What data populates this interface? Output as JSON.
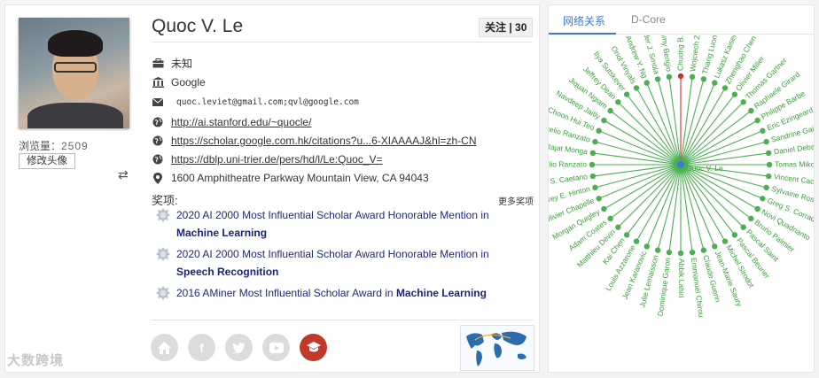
{
  "profile": {
    "views_label": "浏览量：",
    "views_count": "2509",
    "edit_avatar_label": "修改头像",
    "name": "Quoc V. Le",
    "follow_label": "关注 | 30",
    "position": "未知",
    "affiliation": "Google",
    "emails": "quoc.leviet@gmail.com;qvl@google.com",
    "links": [
      "http://ai.stanford.edu/~quocle/",
      "https://scholar.google.com.hk/citations?u...6-XIAAAAJ&hl=zh-CN",
      "https://dblp.uni-trier.de/pers/hd/l/Le:Quoc_V="
    ],
    "address": "1600 Amphitheatre Parkway Mountain View, CA 94043"
  },
  "awards": {
    "title": "奖项:",
    "more_label": "更多奖项",
    "items": [
      {
        "text": "2020 AI 2000 Most Influential Scholar Award Honorable Mention in",
        "field": "Machine Learning"
      },
      {
        "text": "2020 AI 2000 Most Influential Scholar Award Honorable Mention in",
        "field": "Speech Recognition"
      },
      {
        "text": "2016 AMiner Most Influential Scholar Award in",
        "field": "Machine Learning"
      }
    ]
  },
  "social_icons": [
    "home-icon",
    "facebook-icon",
    "twitter-icon",
    "youtube-icon",
    "scholar-cap-icon"
  ],
  "graph_panel": {
    "tabs": [
      "网络关系",
      "D-Core"
    ],
    "active_tab": 0,
    "center_label": "Quoc V. Le",
    "highlight_node": "Chuong B. Do",
    "colors": {
      "node": "#4caf50",
      "center": "#3a7bd5",
      "highlight": "#d32f2f"
    },
    "nodes": [
      "Chuong B. Do",
      "Wojciech Zaremba",
      "Thang Luong",
      "Lukasz Kaiser",
      "Zhenghao Chen",
      "Olivier Miller",
      "Thomas Gartner",
      "Raphaele Girard",
      "Philippe Barbe",
      "Eric Ezingeard",
      "Sandrine Gaillot",
      "Daniel Debas",
      "Tomas Mikolov",
      "Vincent Caciani",
      "Sylvaine Rose",
      "Greg S. Corrado",
      "Novi Quadrianto",
      "Bruno Palmier",
      "Pascal Saint",
      "Pascal Beurier",
      "Michel Sirodot",
      "Jean-Marie Saury",
      "Claude Guerin",
      "Emmanuel Chirou",
      "Abbik Lahiri",
      "Dominique Garon",
      "Julie Lemaisson",
      "Jean Karanovic",
      "Louis Azzarone",
      "Kai Chen",
      "Matthieu Devin",
      "Adam Coates",
      "Morgan Quigley",
      "Olivier Chapelle",
      "Jeffrey E. Hinton",
      "Jean S. Caetano",
      "Aurelio Ranzato",
      "Rajat Monga",
      "Aurelio Ranzato",
      "Choon Hui Teo",
      "Navdeep Jaitly",
      "Jiquan Ngiam",
      "Jeffrey Dean",
      "Ilya Sutskever",
      "Oriol Vinyals",
      "Andrew Y. Ng",
      "Alexander J. Smola",
      "Samy Bengio"
    ]
  },
  "watermark": "大数跨境"
}
